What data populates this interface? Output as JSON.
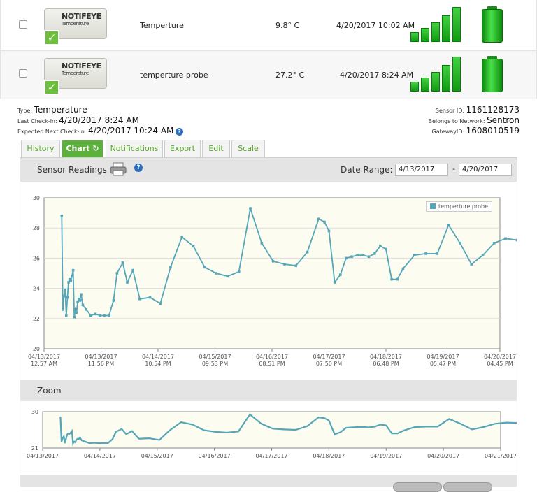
{
  "sensors": [
    {
      "name": "Temperture",
      "reading": "9.8° C",
      "checkin": "4/20/2017 10:02 AM",
      "device_brand": "NOTIFEYE",
      "device_sub": "Temperature"
    },
    {
      "name": "temperture probe",
      "reading": "27.2° C",
      "checkin": "4/20/2017 8:24 AM",
      "device_brand": "NOTIFEYE",
      "device_sub": "Temperature"
    }
  ],
  "details": {
    "type_label": "Type:",
    "type_value": "Temperature",
    "last_label": "Last Check-in:",
    "last_value": "4/20/2017 8:24 AM",
    "next_label": "Expected Next Check-in:",
    "next_value": "4/20/2017 10:24 AM",
    "sensor_id_label": "Sensor ID:",
    "sensor_id_value": "1161128173",
    "network_label": "Belongs to Network:",
    "network_value": "Sentron",
    "gateway_label": "GatewayID:",
    "gateway_value": "1608010519"
  },
  "tabs": [
    {
      "label": "History",
      "active": false
    },
    {
      "label": "Chart",
      "active": true
    },
    {
      "label": "Notifications",
      "active": false
    },
    {
      "label": "Export",
      "active": false
    },
    {
      "label": "Edit",
      "active": false
    },
    {
      "label": "Scale",
      "active": false
    }
  ],
  "readings_panel": {
    "title": "Sensor Readings",
    "date_range_label": "Date Range:",
    "date_from": "4/13/2017",
    "date_to": "4/20/2017",
    "separator": "-"
  },
  "zoom_panel": {
    "title": "Zoom"
  },
  "chart_data": [
    {
      "type": "line",
      "title": "",
      "series": [
        {
          "name": "temperture probe",
          "color": "#54a6b8"
        }
      ],
      "ylim": [
        20,
        30
      ],
      "yticks": [
        "20",
        "22",
        "24",
        "26",
        "28",
        "30"
      ],
      "xticks": [
        "04/13/2017 12:57 AM",
        "04/13/2017 11:56 PM",
        "04/14/2017 10:54 PM",
        "04/15/2017 09:53 PM",
        "04/16/2017 08:51 PM",
        "04/17/2017 07:50 PM",
        "04/18/2017 06:48 PM",
        "04/19/2017 05:47 PM",
        "04/20/2017 04:45 PM"
      ],
      "x_range": [
        0,
        8
      ],
      "points": [
        [
          0.31,
          28.8
        ],
        [
          0.33,
          22.6
        ],
        [
          0.35,
          23.5
        ],
        [
          0.37,
          23.9
        ],
        [
          0.39,
          22.2
        ],
        [
          0.41,
          23.4
        ],
        [
          0.43,
          24.4
        ],
        [
          0.45,
          24.6
        ],
        [
          0.47,
          24.5
        ],
        [
          0.49,
          24.8
        ],
        [
          0.51,
          25.2
        ],
        [
          0.53,
          22.1
        ],
        [
          0.55,
          22.6
        ],
        [
          0.57,
          22.4
        ],
        [
          0.59,
          23.1
        ],
        [
          0.61,
          23.3
        ],
        [
          0.63,
          23.2
        ],
        [
          0.65,
          23.6
        ],
        [
          0.68,
          22.9
        ],
        [
          0.74,
          22.6
        ],
        [
          0.82,
          22.2
        ],
        [
          0.9,
          22.3
        ],
        [
          0.98,
          22.2
        ],
        [
          1.06,
          22.2
        ],
        [
          1.14,
          22.2
        ],
        [
          1.22,
          23.2
        ],
        [
          1.28,
          25.0
        ],
        [
          1.38,
          25.7
        ],
        [
          1.46,
          24.4
        ],
        [
          1.56,
          25.2
        ],
        [
          1.68,
          23.3
        ],
        [
          1.86,
          23.4
        ],
        [
          2.04,
          23.0
        ],
        [
          2.22,
          25.4
        ],
        [
          2.42,
          27.4
        ],
        [
          2.62,
          26.8
        ],
        [
          2.82,
          25.4
        ],
        [
          3.02,
          25.0
        ],
        [
          3.22,
          24.8
        ],
        [
          3.42,
          25.1
        ],
        [
          3.62,
          29.3
        ],
        [
          3.82,
          27.0
        ],
        [
          4.02,
          25.8
        ],
        [
          4.22,
          25.6
        ],
        [
          4.42,
          25.5
        ],
        [
          4.62,
          26.4
        ],
        [
          4.82,
          28.6
        ],
        [
          4.92,
          28.4
        ],
        [
          5.0,
          27.8
        ],
        [
          5.1,
          24.4
        ],
        [
          5.2,
          24.9
        ],
        [
          5.3,
          26.0
        ],
        [
          5.4,
          26.1
        ],
        [
          5.5,
          26.2
        ],
        [
          5.6,
          26.2
        ],
        [
          5.7,
          26.1
        ],
        [
          5.8,
          26.3
        ],
        [
          5.9,
          26.8
        ],
        [
          6.0,
          26.6
        ],
        [
          6.1,
          24.6
        ],
        [
          6.2,
          24.6
        ],
        [
          6.3,
          25.3
        ],
        [
          6.5,
          26.2
        ],
        [
          6.7,
          26.3
        ],
        [
          6.9,
          26.3
        ],
        [
          7.1,
          28.2
        ],
        [
          7.3,
          27.0
        ],
        [
          7.5,
          25.6
        ],
        [
          7.7,
          26.2
        ],
        [
          7.9,
          27.0
        ],
        [
          8.1,
          27.3
        ],
        [
          8.3,
          27.2
        ]
      ]
    },
    {
      "type": "line",
      "title": "",
      "ylim": [
        21,
        30
      ],
      "yticks": [
        "21",
        "30"
      ],
      "xticks": [
        "04/13/2017",
        "04/14/2017",
        "04/15/2017",
        "04/16/2017",
        "04/17/2017",
        "04/18/2017",
        "04/19/2017",
        "04/20/2017",
        "04/21/2017"
      ]
    }
  ]
}
